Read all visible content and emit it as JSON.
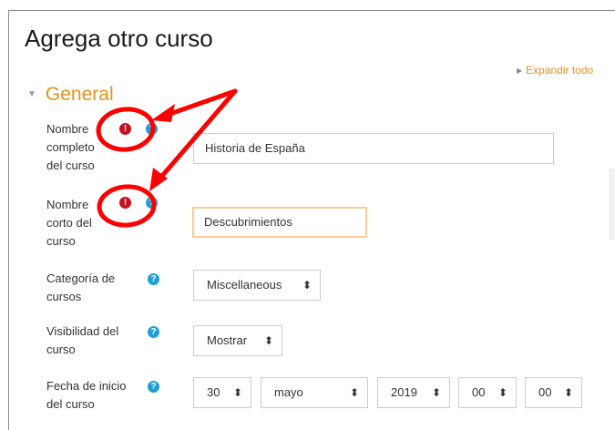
{
  "page": {
    "title": "Agrega otro curso",
    "expand_all": "Expandir todo"
  },
  "section": {
    "title": "General"
  },
  "fields": {
    "fullname": {
      "label": [
        "Nombre",
        "completo",
        "del curso"
      ],
      "value": "Historia de España"
    },
    "shortname": {
      "label": [
        "Nombre",
        "corto del",
        "curso"
      ],
      "value": "Descubrimientos"
    },
    "category": {
      "label": [
        "Categoría de",
        "cursos"
      ],
      "value": "Miscellaneous"
    },
    "visibility": {
      "label": [
        "Visibilidad del",
        "curso"
      ],
      "value": "Mostrar"
    },
    "startdate": {
      "label": [
        "Fecha de inicio",
        "del curso"
      ],
      "day": "30",
      "month": "mayo",
      "year": "2019",
      "hour": "00",
      "minute": "00"
    }
  },
  "icons": {
    "required": "exclamation-circle-icon",
    "help": "question-circle-icon",
    "expand": "triangle-right-icon",
    "collapse": "triangle-down-icon"
  },
  "colors": {
    "accent": "#e8901a",
    "required": "#c8101e",
    "help": "#1e9fd6",
    "annotation": "#ff0000",
    "focus_border": "#f9cd94"
  }
}
